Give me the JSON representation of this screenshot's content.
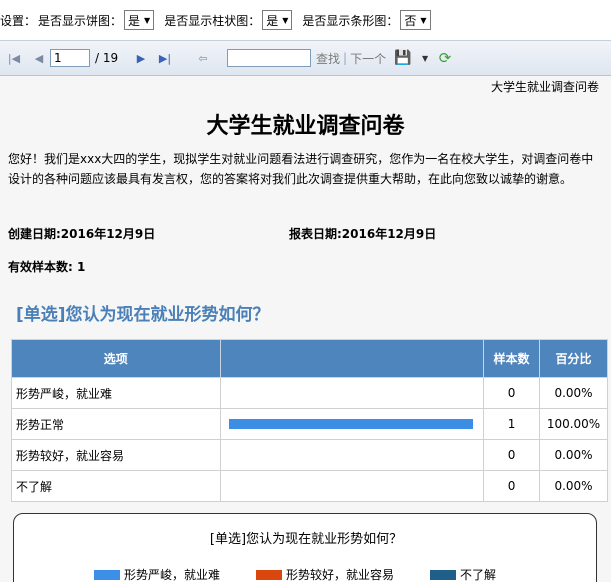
{
  "settings": {
    "prefix": "设置：",
    "pie_label": "是否显示饼图：",
    "pie_value": "是",
    "bar_label": "是否显示柱状图：",
    "bar_value": "是",
    "hbar_label": "是否显示条形图：",
    "hbar_value": "否"
  },
  "toolbar": {
    "page_current": "1",
    "page_total": "/ 19",
    "find_label": "查找",
    "next_label": "下一个"
  },
  "report": {
    "crumb": "大学生就业调查问卷",
    "title": "大学生就业调查问卷",
    "intro": "您好！我们是xxx大四的学生，现拟学生对就业问题看法进行调查研究，您作为一名在校大学生，对调查问卷中设计的各种问题应该最具有发言权，您的答案将对我们此次调查提供重大帮助，在此向您致以诚挚的谢意。",
    "created": "创建日期:2016年12月9日",
    "reported": "报表日期:2016年12月9日",
    "samples": "有效样本数: 1",
    "question": "[单选]您认为现在就业形势如何？",
    "table": {
      "headers": [
        "选项",
        "",
        "样本数",
        "百分比"
      ],
      "rows": [
        {
          "option": "形势严峻，就业难",
          "count": "0",
          "percent": "0.00%",
          "fraction": 0
        },
        {
          "option": "形势正常",
          "count": "1",
          "percent": "100.00%",
          "fraction": 1
        },
        {
          "option": "形势较好，就业容易",
          "count": "0",
          "percent": "0.00%",
          "fraction": 0
        },
        {
          "option": "不了解",
          "count": "0",
          "percent": "0.00%",
          "fraction": 0
        }
      ]
    },
    "chart": {
      "title": "[单选]您认为现在就业形势如何？",
      "legend": [
        {
          "label": "形势严峻，就业难",
          "color": "#3b8fe6"
        },
        {
          "label": "形势较好，就业容易",
          "color": "#d9470f"
        },
        {
          "label": "不了解",
          "color": "#1f5f8a"
        }
      ]
    }
  }
}
